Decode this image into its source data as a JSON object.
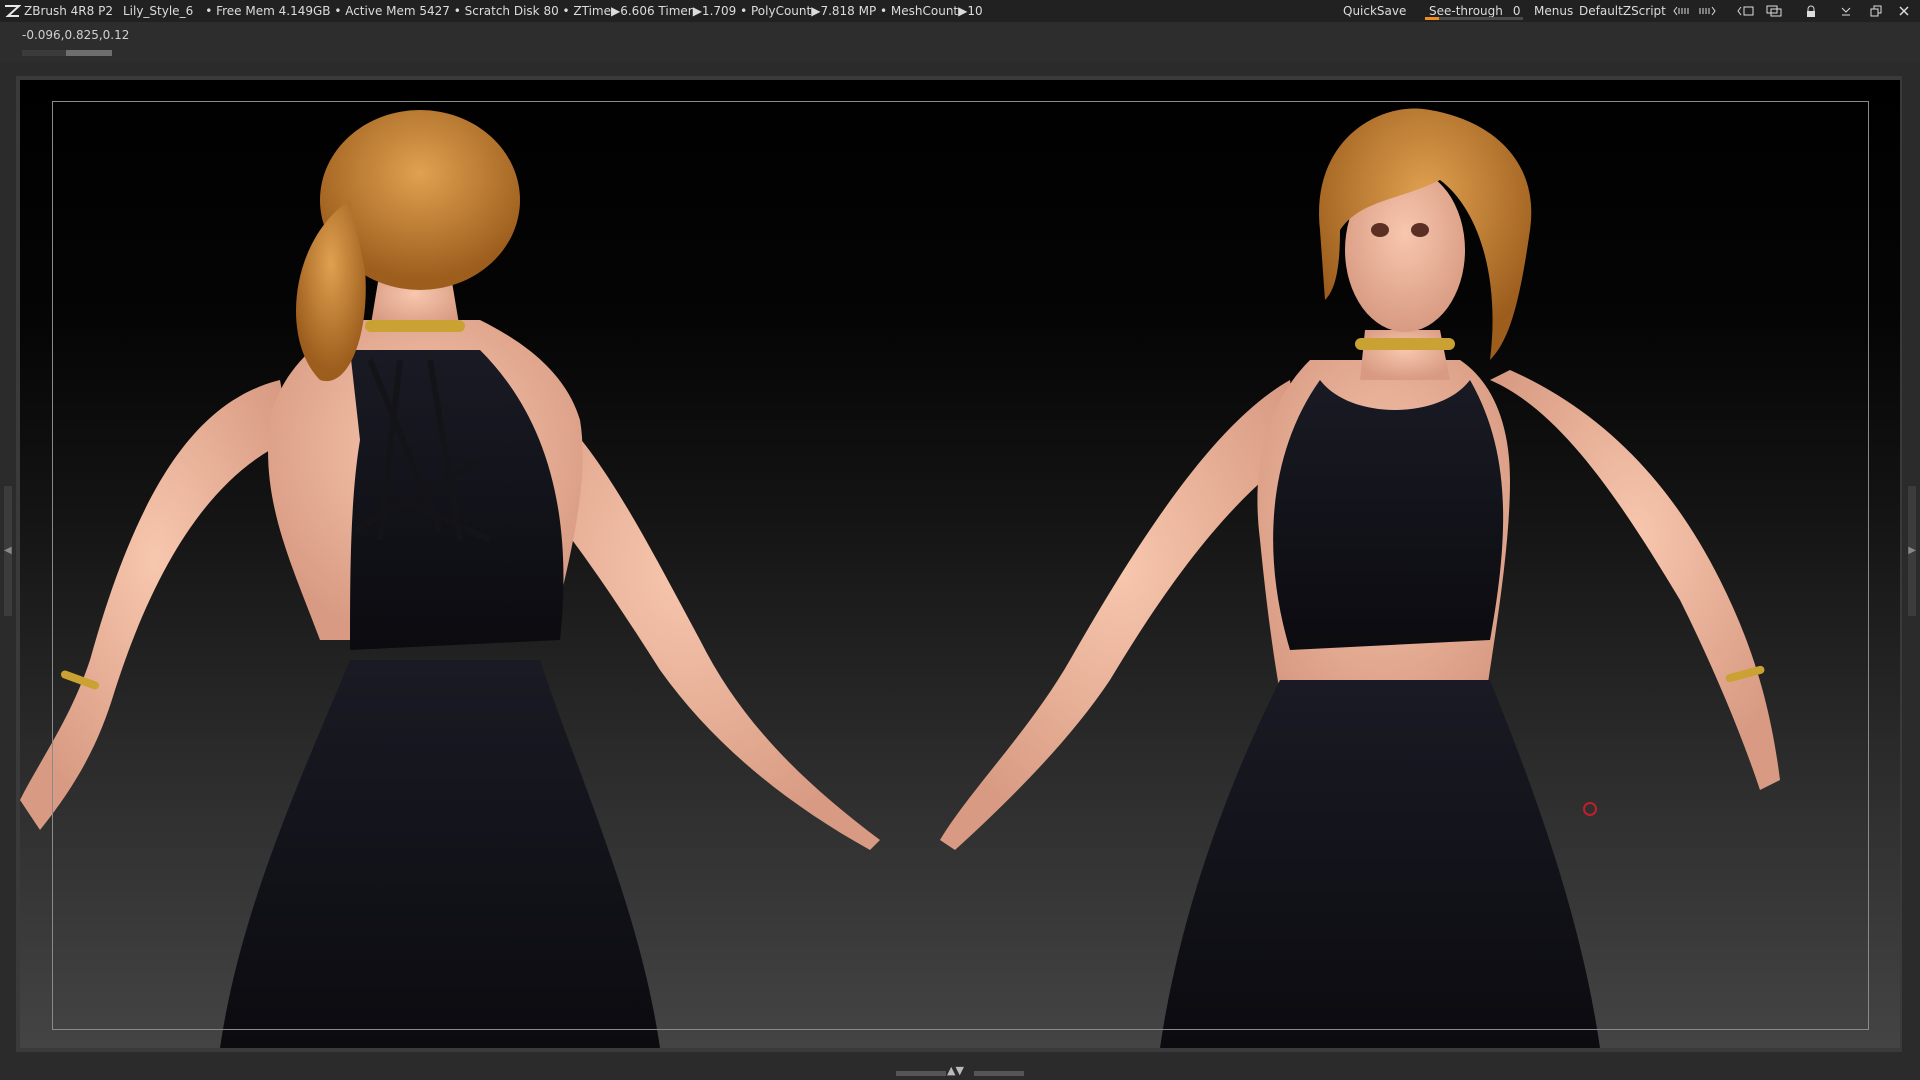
{
  "titlebar": {
    "app_name": "ZBrush 4R8 P2",
    "document": "Lily_Style_6",
    "status": "• Free Mem 4.149GB • Active Mem 5427 • Scratch Disk 80 •  ZTime▶6.606 Timer▶1.709 • PolyCount▶7.818 MP  • MeshCount▶10",
    "quicksave_label": "QuickSave",
    "seethrough_label": "See-through",
    "seethrough_value": "0",
    "seethrough_level": 0,
    "menus_label": "Menus",
    "script_label": "DefaultZScript",
    "icons": [
      "palette-left-icon",
      "palette-right-icon",
      "undock-icon",
      "layout-icon",
      "lock-icon",
      "minimize-icon",
      "restore-icon",
      "close-icon"
    ]
  },
  "readout": {
    "coords": "-0.096,0.825,0.12"
  },
  "viewport": {
    "scene": "two stylized female character renders (back view and front view) in black dress",
    "background_top": "#000000",
    "background_bottom": "#444444",
    "frame_color": "#8a8a8a",
    "cursor_color": "#c0202a"
  },
  "colors": {
    "accent": "#f28c1e",
    "bar_bg": "#212121",
    "ui_bg": "#2b2b2b"
  }
}
